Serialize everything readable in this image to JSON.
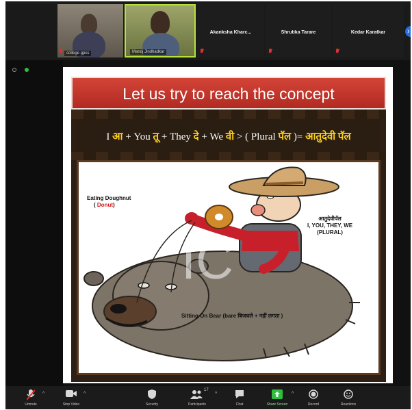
{
  "participants": [
    {
      "name": "",
      "label": "college gpcs",
      "video": true
    },
    {
      "name": "",
      "label": "Manoj Jindhadkar",
      "video": true
    },
    {
      "name": "Akanksha Kharc...",
      "label": "",
      "video": false
    },
    {
      "name": "Shrutika Tarare",
      "label": "",
      "video": false
    },
    {
      "name": "Kedar Karatkar",
      "label": "",
      "video": false
    }
  ],
  "slide": {
    "title": "Let us try to reach the concept",
    "formula": {
      "p1": "I ",
      "w1": "आ",
      "p2": " + You ",
      "w2": "तू",
      "p3": " + They ",
      "w3": "दे",
      "p4": " + We ",
      "w4": "वी",
      "p5": " > ( Plural ",
      "w5": "पॅल",
      "p6": " )= ",
      "w6": "आतुदेवी पॅल"
    },
    "watermark": "IC",
    "annotations": {
      "eating_line1": "Eating Doughnut",
      "eating_open": "( ",
      "eating_word": "Donut",
      "eating_close": ")",
      "right_line1": "आतुदेवीपॅल",
      "right_line2": "I, YOU, THEY, WE",
      "right_line3": "(PLURAL)",
      "bottom": "Sitting On Bear (bare बिजवले + नहीं लगता )"
    }
  },
  "toolbar": {
    "unmute": "Unmute",
    "start_video": "Stop Video",
    "security": "Security",
    "participants": "Participants",
    "participants_count": "17",
    "chat": "Chat",
    "share_screen": "Share Screen",
    "record": "Record",
    "reactions": "Reactions"
  },
  "colors": {
    "title_bar": "#c53a2e",
    "share_green": "#2fbf3f",
    "muted_red": "#e03030",
    "accent_blue": "#1f6fe0",
    "highlight_yellow": "#ffd21f"
  }
}
